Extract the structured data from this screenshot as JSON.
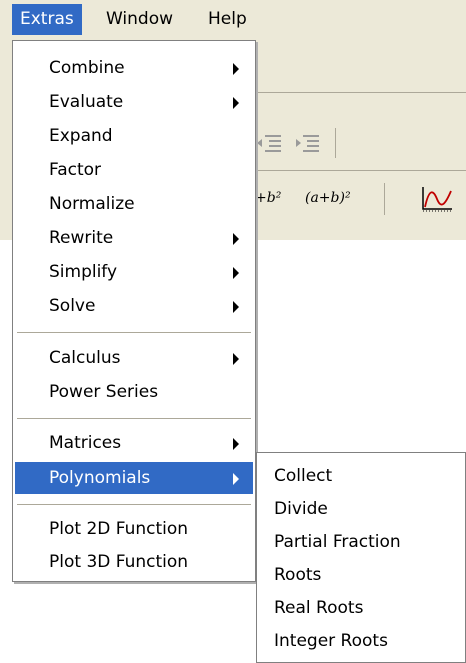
{
  "menubar": {
    "items": [
      {
        "label": "Extras"
      },
      {
        "label": "Window"
      },
      {
        "label": "Help"
      }
    ]
  },
  "toolbar": {
    "expr1": "+b²",
    "expr2": "(a+b)²"
  },
  "extras_menu": {
    "items": [
      {
        "label": "Combine",
        "submenu": true
      },
      {
        "label": "Evaluate",
        "submenu": true
      },
      {
        "label": "Expand",
        "submenu": false
      },
      {
        "label": "Factor",
        "submenu": false
      },
      {
        "label": "Normalize",
        "submenu": false
      },
      {
        "label": "Rewrite",
        "submenu": true
      },
      {
        "label": "Simplify",
        "submenu": true
      },
      {
        "label": "Solve",
        "submenu": true
      },
      {
        "label": "Calculus",
        "submenu": true
      },
      {
        "label": "Power Series",
        "submenu": false
      },
      {
        "label": "Matrices",
        "submenu": true
      },
      {
        "label": "Polynomials",
        "submenu": true,
        "active": true
      },
      {
        "label": "Plot 2D Function",
        "submenu": false
      },
      {
        "label": "Plot 3D Function",
        "submenu": false
      }
    ]
  },
  "polynomials_submenu": {
    "items": [
      {
        "label": "Collect"
      },
      {
        "label": "Divide"
      },
      {
        "label": "Partial Fraction"
      },
      {
        "label": "Roots"
      },
      {
        "label": "Real Roots"
      },
      {
        "label": "Integer Roots"
      }
    ]
  },
  "colors": {
    "highlight": "#316ac5",
    "menu_bg": "#ffffff",
    "chrome": "#ece9d8",
    "plot_icon": "#c00000"
  }
}
